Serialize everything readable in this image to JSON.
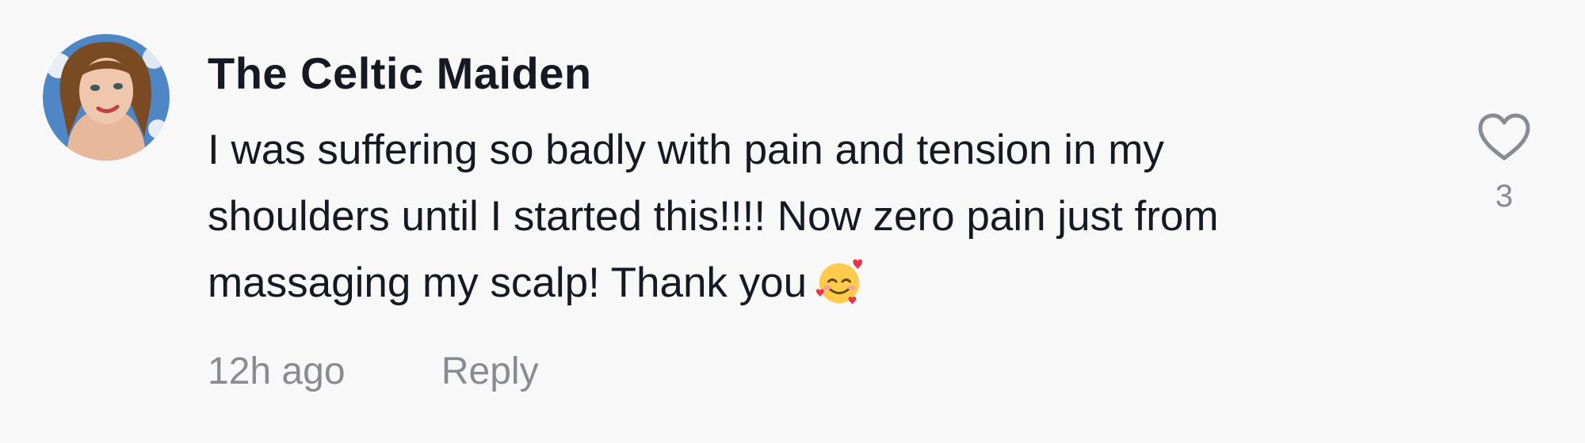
{
  "comment": {
    "author": "The Celtic Maiden",
    "text_lines": [
      "I was suffering so badly with pain and tension in my",
      "shoulders until I started this!!!! Now zero pain just from",
      "massaging my scalp! Thank you"
    ],
    "emoji": "smiling-face-with-hearts",
    "timestamp": "12h ago",
    "reply_label": "Reply",
    "like_count": "3"
  },
  "icons": {
    "like": "heart-outline-icon"
  },
  "colors": {
    "background": "#f8f8f8",
    "text_primary": "#161823",
    "text_secondary": "#8a8b91"
  }
}
